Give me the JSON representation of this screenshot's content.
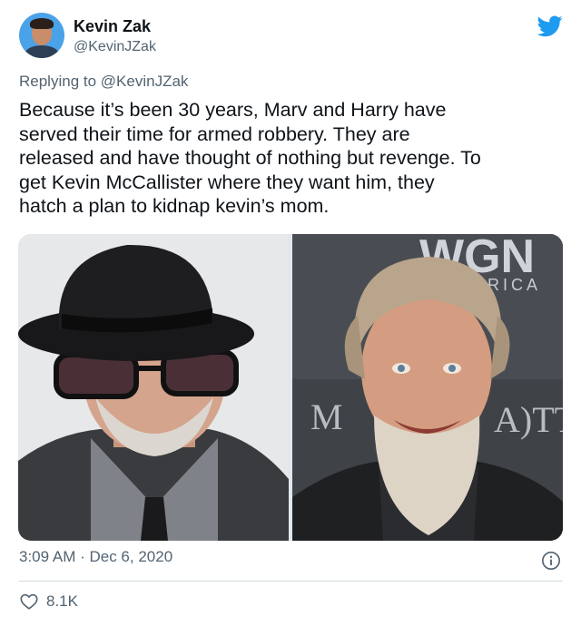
{
  "author": {
    "name": "Kevin Zak",
    "handle": "@KevinJZak"
  },
  "reply": {
    "prefix": "Replying to ",
    "mention": "@KevinJZak"
  },
  "text": "Because it’s been 30 years, Marv and Harry have\nserved their time for armed robbery. They are\nreleased and have thought of nothing but revenge. To\nget Kevin McCallister where they want him, they\nhatch a plan to kidnap kevin’s mom.",
  "media": {
    "left_photo": {
      "description_icon": "man-in-fedora-photo"
    },
    "right_photo": {
      "description_icon": "bearded-man-photo",
      "backdrop_text": "WGN",
      "backdrop_sub": "RICA",
      "backdrop_text2": "M",
      "backdrop_text3": "A)TT"
    }
  },
  "footer": {
    "timestamp": "3:09 AM · Dec 6, 2020",
    "likes": "8.1K"
  },
  "colors": {
    "twitter_blue": "#1d9bf0",
    "secondary_text": "#536471"
  }
}
